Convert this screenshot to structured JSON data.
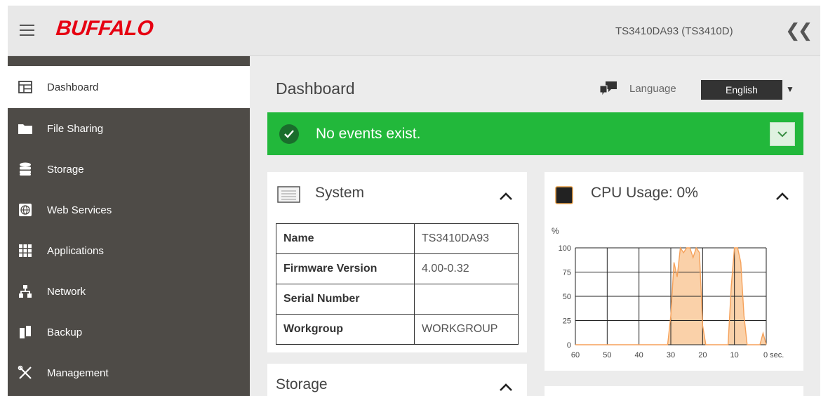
{
  "header": {
    "brand": "BUFFALO",
    "device_name": "TS3410DA93 (TS3410D)",
    "menu_icon": "hamburger-icon",
    "collapse_icon": "double-chevron-left-icon"
  },
  "sidebar": {
    "items": [
      {
        "label": "Dashboard",
        "icon": "dashboard-icon",
        "active": true
      },
      {
        "label": "File Sharing",
        "icon": "folder-icon",
        "active": false
      },
      {
        "label": "Storage",
        "icon": "database-icon",
        "active": false
      },
      {
        "label": "Web Services",
        "icon": "globe-icon",
        "active": false
      },
      {
        "label": "Applications",
        "icon": "apps-grid-icon",
        "active": false
      },
      {
        "label": "Network",
        "icon": "network-icon",
        "active": false
      },
      {
        "label": "Backup",
        "icon": "backup-icon",
        "active": false
      },
      {
        "label": "Management",
        "icon": "tools-icon",
        "active": false
      }
    ]
  },
  "main": {
    "title": "Dashboard",
    "language_label": "Language",
    "language_value": "English",
    "events": {
      "message": "No events exist.",
      "color": "#22b83b"
    },
    "system_card": {
      "title": "System",
      "rows": [
        {
          "key": "Name",
          "value": "TS3410DA93"
        },
        {
          "key": "Firmware Version",
          "value": "4.00-0.32"
        },
        {
          "key": "Serial Number",
          "value": ""
        },
        {
          "key": "Workgroup",
          "value": "WORKGROUP"
        }
      ]
    },
    "cpu_card": {
      "title": "CPU Usage: 0%"
    },
    "storage_card": {
      "title": "Storage"
    }
  },
  "chart_data": {
    "type": "area",
    "title": "CPU Usage: 0%",
    "ylabel": "%",
    "xlabel": "sec.",
    "xlim": [
      60,
      0
    ],
    "ylim": [
      0,
      100
    ],
    "yticks": [
      "0",
      "25",
      "50",
      "75",
      "100"
    ],
    "xticks": [
      "60",
      "50",
      "40",
      "30",
      "20",
      "10",
      "0 sec."
    ],
    "grid": true,
    "color": "#f5a15a",
    "series": [
      {
        "x": [
          60,
          31,
          30,
          29,
          28,
          27,
          26,
          25,
          24,
          23,
          22,
          21,
          20,
          19,
          12,
          11,
          10,
          9,
          8,
          7,
          6,
          2,
          1,
          0
        ],
        "y": [
          0,
          0,
          30,
          85,
          70,
          100,
          95,
          100,
          100,
          90,
          100,
          95,
          20,
          0,
          0,
          60,
          100,
          100,
          85,
          30,
          0,
          0,
          12,
          0
        ]
      }
    ]
  }
}
